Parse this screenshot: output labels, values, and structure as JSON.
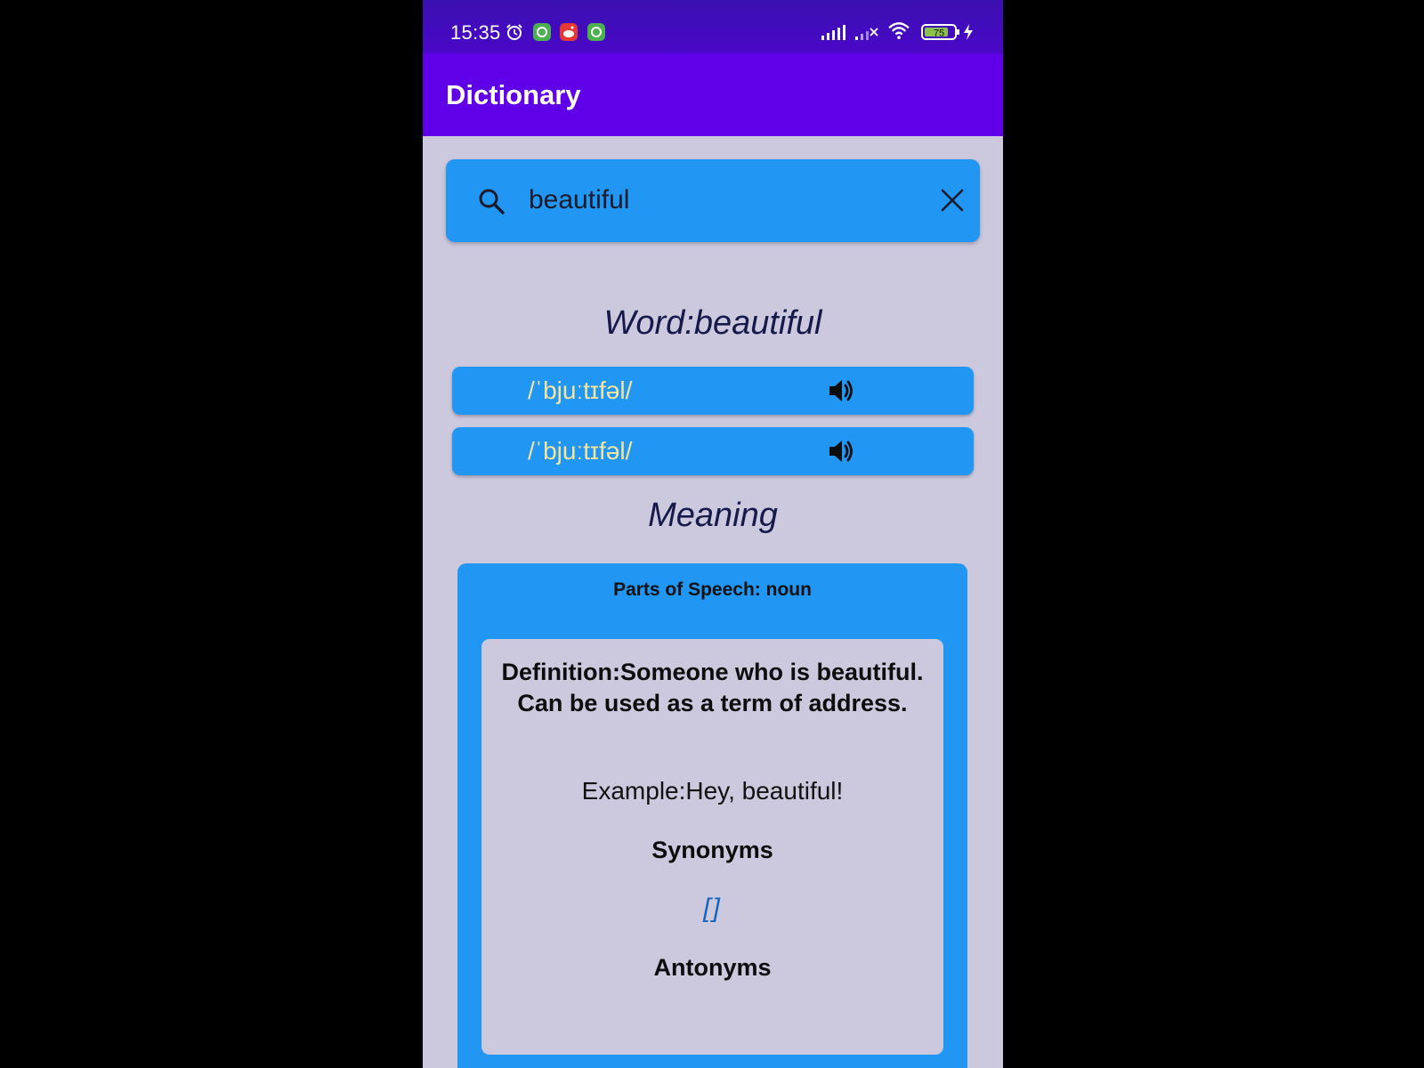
{
  "status_bar": {
    "time": "15:35",
    "battery": "75",
    "icons": [
      "alarm-icon",
      "app-notification-icon",
      "reddit-icon",
      "app-notification-icon",
      "signal-icon",
      "signal-weak-icon",
      "wifi-icon",
      "battery-icon",
      "charging-icon"
    ]
  },
  "app_bar": {
    "title": "Dictionary"
  },
  "search": {
    "value": "beautiful",
    "icon": "search-icon",
    "clear_icon": "close-icon"
  },
  "word": {
    "heading": "Word:beautiful"
  },
  "phonetics": [
    {
      "text": "/ˈbjuːtɪfəl/",
      "icon": "speaker-icon"
    },
    {
      "text": "/ˈbjuːtɪfəl/",
      "icon": "speaker-icon"
    }
  ],
  "meaning": {
    "heading": "Meaning",
    "parts_of_speech": "Parts of Speech: noun",
    "definition": "Definition:Someone who is beautiful. Can be used as a term of address.",
    "example": "Example:Hey, beautiful!",
    "synonyms_label": "Synonyms",
    "synonyms_value": "[]",
    "antonyms_label": "Antonyms"
  },
  "colors": {
    "status_bar": "#4a08c8",
    "app_bar": "#5f00e8",
    "accent_blue": "#2196f3",
    "background": "#ccc8de",
    "phonetic_text": "#f4e59a"
  }
}
